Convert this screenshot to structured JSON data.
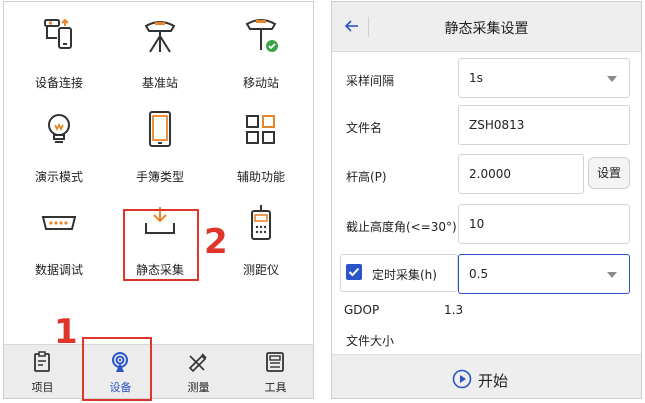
{
  "left_panel": {
    "grid": [
      {
        "label": "设备连接",
        "icon": "device-connect-icon"
      },
      {
        "label": "基准站",
        "icon": "base-station-icon"
      },
      {
        "label": "移动站",
        "icon": "rover-station-icon"
      },
      {
        "label": "演示模式",
        "icon": "lightbulb-icon"
      },
      {
        "label": "手簿类型",
        "icon": "handheld-icon"
      },
      {
        "label": "辅助功能",
        "icon": "grid-apps-icon"
      },
      {
        "label": "数据调试",
        "icon": "serial-port-icon"
      },
      {
        "label": "静态采集",
        "icon": "download-tray-icon"
      },
      {
        "label": "测距仪",
        "icon": "rangefinder-icon"
      }
    ],
    "tabs": [
      {
        "label": "项目",
        "icon": "clipboard-icon"
      },
      {
        "label": "设备",
        "icon": "antenna-icon"
      },
      {
        "label": "测量",
        "icon": "pen-ruler-icon"
      },
      {
        "label": "工具",
        "icon": "calculator-icon"
      }
    ],
    "annotations": {
      "marker1": "1",
      "marker2": "2"
    }
  },
  "right_panel": {
    "title": "静态采集设置",
    "fields": {
      "sample_interval": {
        "label": "采样间隔",
        "value": "1s"
      },
      "filename": {
        "label": "文件名",
        "value": "ZSH0813"
      },
      "pole_height": {
        "label": "杆高(P)",
        "value": "2.0000",
        "button": "设置"
      },
      "cutoff": {
        "label": "截止高度角(<=30°)",
        "value": "10"
      },
      "timed": {
        "label": "定时采集(h)",
        "value": "0.5",
        "checked": true
      }
    },
    "gdop": {
      "label": "GDOP",
      "value": "1.3"
    },
    "file_size": {
      "label": "文件大小"
    },
    "start_button": "开始"
  },
  "colors": {
    "accent": "#2a55c9",
    "icon_orange": "#e8862a",
    "annotation_red": "#e0352b",
    "check_green": "#3aa34a"
  }
}
